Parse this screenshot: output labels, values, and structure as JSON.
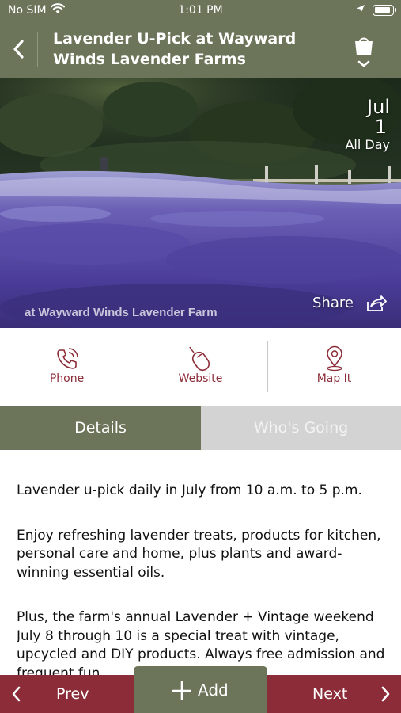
{
  "status_bar": {
    "carrier": "No SIM",
    "time": "1:01 PM",
    "icons": [
      "wifi-icon",
      "location-arrow-icon",
      "battery-icon"
    ]
  },
  "nav": {
    "back_icon": "chevron-left-icon",
    "title": "Lavender U-Pick at Wayward Winds Lavender Farms",
    "cart_icon": "shopping-bag-icon"
  },
  "hero": {
    "date_month": "Jul",
    "date_day": "1",
    "date_time": "All Day",
    "watermark": "at Wayward Winds Lavender Farm",
    "share_label": "Share",
    "share_icon": "share-arrow-icon"
  },
  "actions": [
    {
      "label": "Phone",
      "icon": "phone-icon"
    },
    {
      "label": "Website",
      "icon": "mouse-icon"
    },
    {
      "label": "Map It",
      "icon": "map-pin-icon"
    }
  ],
  "tabs": {
    "details": "Details",
    "whos_going": "Who's Going",
    "active": "Details"
  },
  "content": {
    "paragraphs": [
      "Lavender u-pick daily in July from 10 a.m. to 5 p.m.",
      "Enjoy refreshing lavender treats, products for kitchen, personal care and home, plus plants and award-winning essential oils.",
      "Plus, the farm's annual Lavender + Vintage weekend July 8 through 10 is a special treat with vintage, upcycled and DIY products.  Always free admission and frequent fun"
    ]
  },
  "bottom_bar": {
    "prev_label": "Prev",
    "add_label": "Add",
    "next_label": "Next"
  },
  "colors": {
    "olive": "#6c7459",
    "maroon": "#8c2c38",
    "tab_inactive": "#d3d3d3"
  }
}
